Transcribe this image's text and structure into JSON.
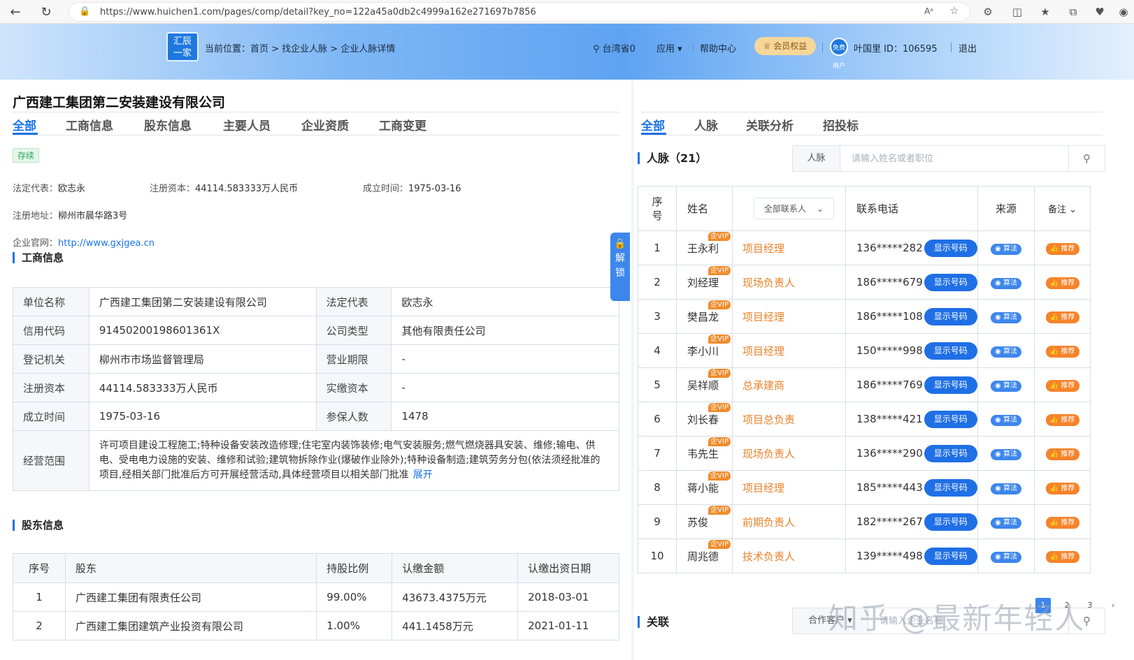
{
  "browser": {
    "url": "https://www.huichen1.com/pages/comp/detail?key_no=122a45a0db2c4999a162e271697b7856",
    "read_aloud_icon": "Aᵃ"
  },
  "header": {
    "logo_line1": "汇辰",
    "logo_line2": "一家",
    "breadcrumb": "当前位置：首页 > 找企业人脉 > 企业人脉详情",
    "location": "台湾省0",
    "apps": "应用 ▾",
    "help": "帮助中心",
    "vip": "会员权益",
    "avatar_text": "免费用户",
    "user": "叶国里 ID：106595",
    "logout": "退出"
  },
  "company": {
    "name": "广西建工集团第二安装建设有限公司",
    "tabs": [
      "全部",
      "工商信息",
      "股东信息",
      "主要人员",
      "企业资质",
      "工商变更"
    ],
    "status": "存续",
    "legal_rep_label": "法定代表：",
    "legal_rep": "欧志永",
    "capital_label": "注册资本：",
    "capital": "44114.583333万人民币",
    "founded_label": "成立时间：",
    "founded": "1975-03-16",
    "address_label": "注册地址：",
    "address": "柳州市晨华路3号",
    "website_label": "企业官网：",
    "website": "http://www.gxjgea.cn",
    "unlock": "解锁"
  },
  "business": {
    "title": "工商信息",
    "rows": [
      {
        "l1": "单位名称",
        "v1": "广西建工集团第二安装建设有限公司",
        "l2": "法定代表",
        "v2": "欧志永"
      },
      {
        "l1": "信用代码",
        "v1": "91450200198601361X",
        "l2": "公司类型",
        "v2": "其他有限责任公司"
      },
      {
        "l1": "登记机关",
        "v1": "柳州市市场监督管理局",
        "l2": "营业期限",
        "v2": "-"
      },
      {
        "l1": "注册资本",
        "v1": "44114.583333万人民币",
        "l2": "实缴资本",
        "v2": "-"
      },
      {
        "l1": "成立时间",
        "v1": "1975-03-16",
        "l2": "参保人数",
        "v2": "1478"
      }
    ],
    "scope_label": "经营范围",
    "scope_text": "许可项目建设工程施工;特种设备安装改造修理;住宅室内装饰装修;电气安装服务;燃气燃烧器具安装、维修;输电、供电、受电电力设施的安装、维修和试验;建筑物拆除作业(爆破作业除外);特种设备制造;建筑劳务分包(依法须经批准的项目,经相关部门批准后方可开展经营活动,具体经营项目以相关部门批准",
    "expand": "展开"
  },
  "shareholders": {
    "title": "股东信息",
    "headers": [
      "序号",
      "股东",
      "持股比例",
      "认缴金额",
      "认缴出资日期"
    ],
    "rows": [
      {
        "no": "1",
        "name": "广西建工集团有限责任公司",
        "ratio": "99.00%",
        "amount": "43673.4375万元",
        "date": "2018-03-01"
      },
      {
        "no": "2",
        "name": "广西建工集团建筑产业投资有限公司",
        "ratio": "1.00%",
        "amount": "441.1458万元",
        "date": "2021-01-11"
      }
    ]
  },
  "right": {
    "tabs": [
      "全部",
      "人脉",
      "关联分析",
      "招投标"
    ],
    "contacts_title": "人脉（21）",
    "search_category": "人脉",
    "search_placeholder": "请输入姓名或者职位",
    "headers": {
      "no": "序号",
      "name": "姓名",
      "filter": "全部联系人",
      "phone": "联系电话",
      "source": "来源",
      "note": "备注"
    },
    "vip_tag": "企VIP",
    "show_label": "显示号码",
    "algo_label": "算法",
    "rec_label": "推荐",
    "rows": [
      {
        "no": "1",
        "name": "王永利",
        "position": "项目经理",
        "phone": "136*****282"
      },
      {
        "no": "2",
        "name": "刘经理",
        "position": "现场负责人",
        "phone": "186*****679"
      },
      {
        "no": "3",
        "name": "樊昌龙",
        "position": "项目经理",
        "phone": "186*****108"
      },
      {
        "no": "4",
        "name": "李小川",
        "position": "项目经理",
        "phone": "150*****998"
      },
      {
        "no": "5",
        "name": "吴祥顺",
        "position": "总承建商",
        "phone": "186*****769"
      },
      {
        "no": "6",
        "name": "刘长春",
        "position": "项目总负责",
        "phone": "138*****421"
      },
      {
        "no": "7",
        "name": "韦先生",
        "position": "现场负责人",
        "phone": "136*****290"
      },
      {
        "no": "8",
        "name": "蒋小能",
        "position": "项目经理",
        "phone": "185*****443"
      },
      {
        "no": "9",
        "name": "苏俊",
        "position": "前期负责人",
        "phone": "182*****267"
      },
      {
        "no": "10",
        "name": "周兆德",
        "position": "技术负责人",
        "phone": "139*****498"
      }
    ],
    "pages": [
      "1",
      "2",
      "3"
    ],
    "relation_title": "关联",
    "relation_category": "合作客户 ▾",
    "relation_placeholder": "请输入企业名称"
  },
  "watermark": "知乎 @最新年轻人",
  "colors": {
    "accent": "#1a73e8",
    "position": "#e8822a",
    "vip": "#f08c2c"
  }
}
